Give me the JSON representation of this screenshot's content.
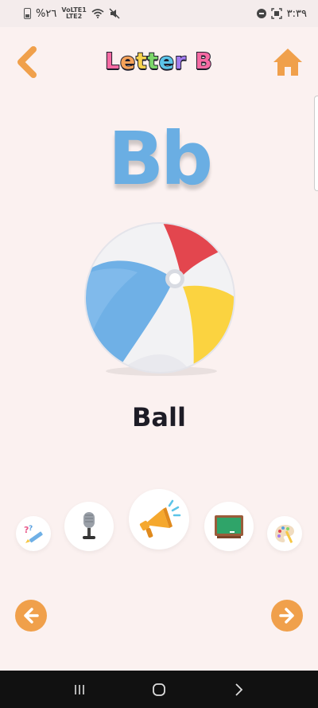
{
  "status_bar": {
    "battery_text": "%٢٦",
    "signal_text_top": "VoLTE1",
    "signal_text_bottom": "LTE2",
    "time": "٣:٣٩"
  },
  "header": {
    "title": "Letter B",
    "back_icon": "chevron-left-icon",
    "home_icon": "home-icon"
  },
  "lesson": {
    "letter": "Bb",
    "word": "Ball",
    "image": "beach-ball"
  },
  "tools": [
    {
      "name": "quiz",
      "icon": "quiz-pencil-icon"
    },
    {
      "name": "record",
      "icon": "microphone-icon"
    },
    {
      "name": "speak",
      "icon": "megaphone-icon"
    },
    {
      "name": "board",
      "icon": "chalkboard-icon"
    },
    {
      "name": "paint",
      "icon": "palette-icon"
    }
  ],
  "navigation": {
    "prev_icon": "arrow-left-icon",
    "next_icon": "arrow-right-icon"
  },
  "system_nav": {
    "recents_icon": "recents-icon",
    "home_icon": "circle-home-icon",
    "back_icon": "chevron-right-icon"
  },
  "colors": {
    "background": "#fbf1f0",
    "accent_orange": "#f0a04b",
    "letter_blue": "#6aaee3",
    "ball_red": "#e3464e",
    "ball_yellow": "#fbd340",
    "ball_blue": "#6fb0e6"
  }
}
